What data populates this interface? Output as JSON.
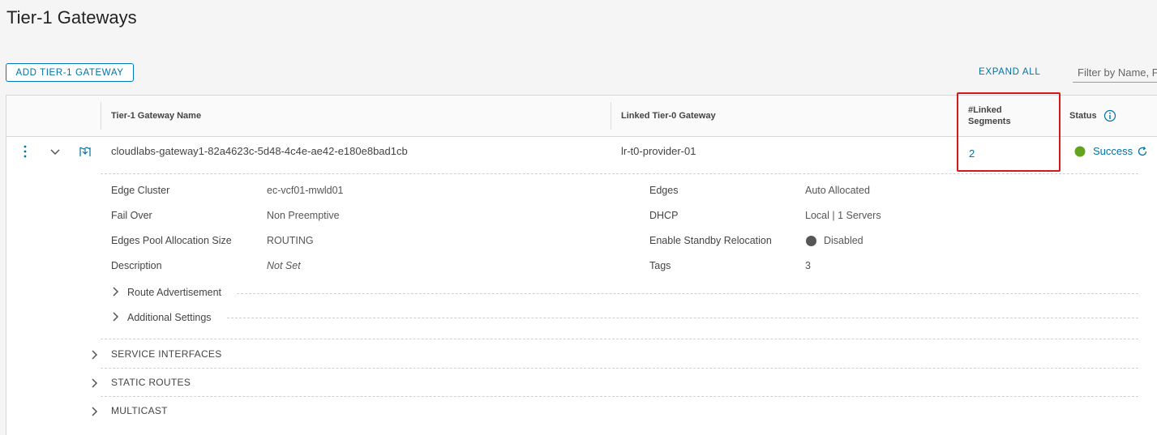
{
  "page": {
    "title": "Tier-1 Gateways"
  },
  "toolbar": {
    "add_label": "ADD TIER-1 GATEWAY",
    "expand_all_label": "EXPAND ALL",
    "filter_placeholder": "Filter by Name, Path and more"
  },
  "table": {
    "headers": {
      "name": "Tier-1 Gateway Name",
      "linked_t0": "Linked Tier-0 Gateway",
      "linked_segments_line1": "#Linked",
      "linked_segments_line2": "Segments",
      "status": "Status"
    },
    "row": {
      "name": "cloudlabs-gateway1-82a4623c-5d48-4c4e-ae42-e180e8bad1cb",
      "linked_t0": "lr-t0-provider-01",
      "linked_segments": "2",
      "status": "Success"
    },
    "details": {
      "left": [
        {
          "label": "Edge Cluster",
          "value": "ec-vcf01-mwld01"
        },
        {
          "label": "Fail Over",
          "value": "Non Preemptive"
        },
        {
          "label": "Edges Pool Allocation Size",
          "value": "ROUTING"
        },
        {
          "label": "Description",
          "value": "Not Set"
        }
      ],
      "right": [
        {
          "label": "Edges",
          "value": "Auto Allocated"
        },
        {
          "label": "DHCP",
          "value": "Local | 1 Servers"
        },
        {
          "label": "Enable Standby Relocation",
          "value": "Disabled"
        },
        {
          "label": "Tags",
          "value": "3"
        }
      ],
      "subsections": [
        "Route Advertisement",
        "Additional Settings"
      ]
    },
    "sections": [
      "SERVICE INTERFACES",
      "STATIC ROUTES",
      "MULTICAST"
    ]
  },
  "colors": {
    "accent": "#0072a3",
    "success": "#62a420",
    "highlight": "#d21a1a",
    "toggle_off": "#565656"
  }
}
